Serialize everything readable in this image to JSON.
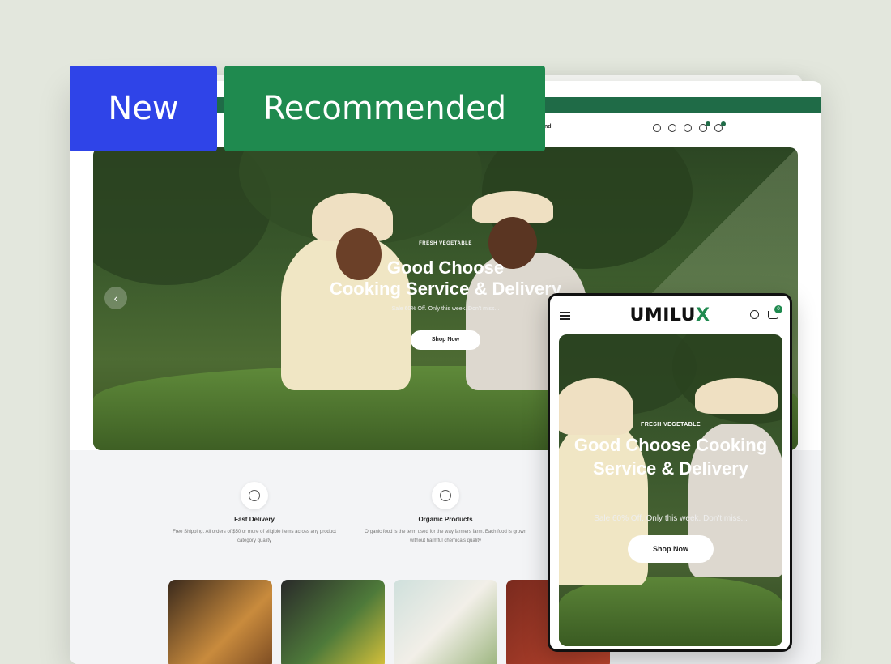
{
  "badges": {
    "new": "New",
    "recommended": "Recommended"
  },
  "desktop": {
    "header_nav_end": "nd",
    "hero": {
      "tag": "FRESH VEGETABLE",
      "title_line1": "Good Choose",
      "title_line2": "Cooking Service & Delivery",
      "subtitle": "Sale 60% Off. Only this week. Don't miss...",
      "button": "Shop Now"
    },
    "features": [
      {
        "title": "Fast Delivery",
        "desc": "Free Shipping. All orders of $50 or more of eligible items across any product category quality"
      },
      {
        "title": "Organic Products",
        "desc": "Organic food is the term used for the way farmers farm. Each food is grown without harmful chemicals quality"
      }
    ]
  },
  "mobile": {
    "logo_main": "UMILU",
    "logo_accent": "X",
    "cart_count": "0",
    "hero": {
      "tag": "FRESH VEGETABLE",
      "title": "Good Choose Cooking Service & Delivery",
      "subtitle": "Sale 60% Off. Only this week. Don't miss...",
      "button": "Shop Now"
    }
  },
  "colors": {
    "brand_green": "#1f8a4f",
    "new_blue": "#2f44e8",
    "dark_green": "#1f6b47"
  }
}
